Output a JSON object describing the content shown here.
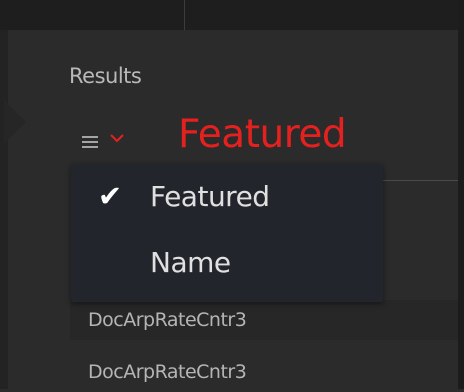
{
  "results": {
    "label": "Results",
    "sort": {
      "menu_icon": "hamburger-menu-icon",
      "chevron_icon": "chevron-down-icon",
      "selected": "Featured",
      "accent_color": "#e52120"
    }
  },
  "dropdown": {
    "options": [
      {
        "label": "Featured",
        "checked": true,
        "check_glyph": "✔"
      },
      {
        "label": "Name",
        "checked": false
      }
    ]
  },
  "list": {
    "items": [
      "DocArpRateCntr3",
      "DocArpRateCntr3"
    ]
  }
}
